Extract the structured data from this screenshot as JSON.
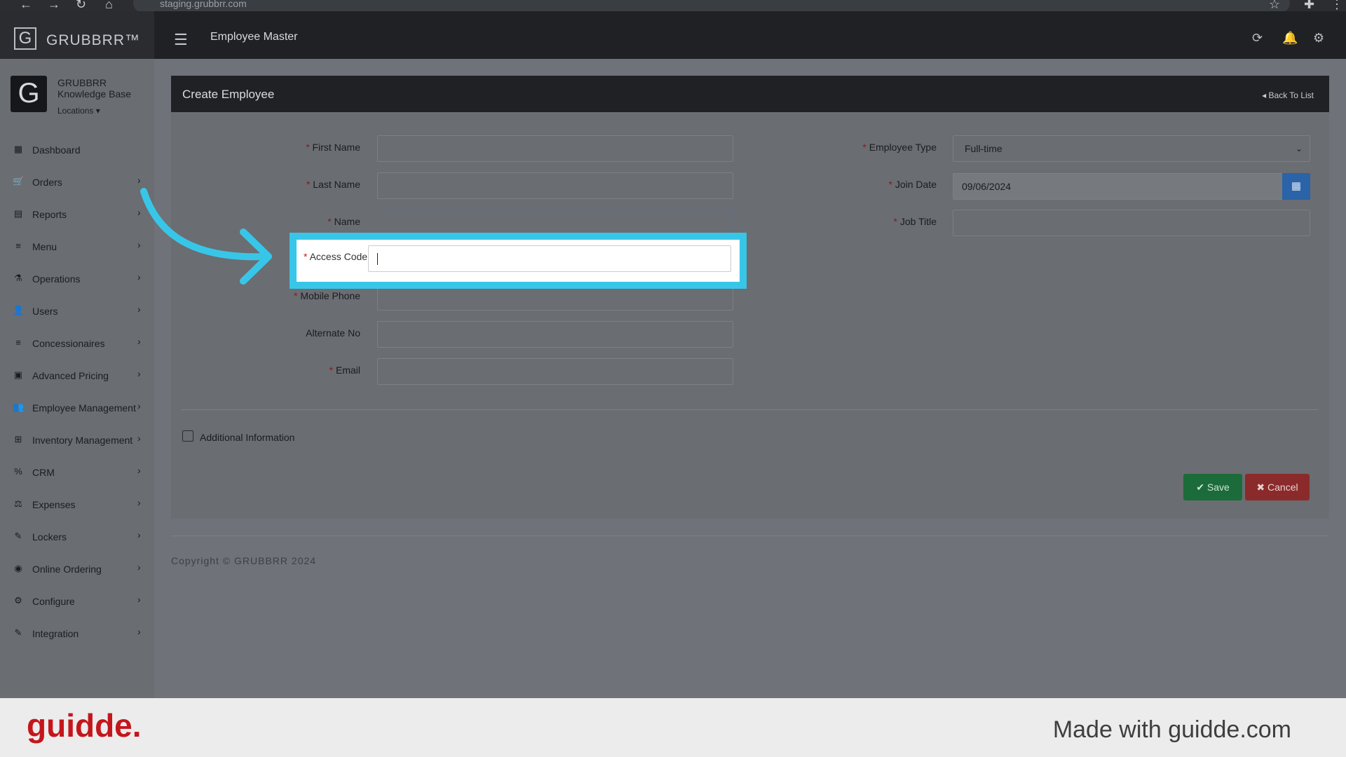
{
  "browser": {
    "url": "staging.grubbrr.com",
    "icons": [
      "back-icon",
      "forward-icon",
      "reload-icon",
      "home-icon",
      "star-icon",
      "extensions-icon",
      "more-icon"
    ]
  },
  "header": {
    "logo_letter": "G",
    "logo_text": "GRUBBRR™",
    "title": "Employee Master",
    "icons": [
      "refresh-icon",
      "bell-icon",
      "gear-icon"
    ]
  },
  "sidebar": {
    "brand_letter": "G",
    "brand_name": "GRUBBRR Knowledge Base",
    "locations_label": "Locations ▾",
    "items": [
      {
        "label": "Dashboard",
        "icon": "▦",
        "chevron": ""
      },
      {
        "label": "Orders",
        "icon": "🛒",
        "chevron": "›"
      },
      {
        "label": "Reports",
        "icon": "▤",
        "chevron": "›"
      },
      {
        "label": "Menu",
        "icon": "≡",
        "chevron": "›"
      },
      {
        "label": "Operations",
        "icon": "⚗",
        "chevron": "›"
      },
      {
        "label": "Users",
        "icon": "👤",
        "chevron": "›"
      },
      {
        "label": "Concessionaires",
        "icon": "≡",
        "chevron": "›"
      },
      {
        "label": "Advanced Pricing",
        "icon": "▣",
        "chevron": "›"
      },
      {
        "label": "Employee Management",
        "icon": "👥",
        "chevron": "›"
      },
      {
        "label": "Inventory Management",
        "icon": "⊞",
        "chevron": "›"
      },
      {
        "label": "CRM",
        "icon": "%",
        "chevron": "›"
      },
      {
        "label": "Expenses",
        "icon": "⚖",
        "chevron": "›"
      },
      {
        "label": "Lockers",
        "icon": "✎",
        "chevron": "›"
      },
      {
        "label": "Online Ordering",
        "icon": "◉",
        "chevron": "›"
      },
      {
        "label": "Configure",
        "icon": "⚙",
        "chevron": "›"
      },
      {
        "label": "Integration",
        "icon": "✎",
        "chevron": "›"
      }
    ]
  },
  "panel": {
    "title": "Create Employee",
    "back_link": "◂ Back To List"
  },
  "form": {
    "required_mark": "*",
    "first_name": {
      "label": "First Name",
      "value": ""
    },
    "last_name": {
      "label": "Last Name",
      "value": ""
    },
    "name": {
      "label": "Name",
      "value": ""
    },
    "access_code": {
      "label": "Access Code",
      "value": ""
    },
    "mobile_phone": {
      "label": "Mobile Phone",
      "value": ""
    },
    "alternate_no": {
      "label": "Alternate No",
      "value": ""
    },
    "email": {
      "label": "Email",
      "value": ""
    },
    "employee_type": {
      "label": "Employee Type",
      "value": "Full-time"
    },
    "join_date": {
      "label": "Join Date",
      "value": "09/06/2024"
    },
    "job_title": {
      "label": "Job Title",
      "value": ""
    },
    "additional_info_label": "Additional Information",
    "additional_info_checked": false
  },
  "actions": {
    "save_label": "✔ Save",
    "cancel_label": "✖ Cancel"
  },
  "footer": {
    "copyright": "Copyright © GRUBBRR 2024"
  },
  "guidde": {
    "logo": "guidde.",
    "made_with": "Made with guidde.com"
  },
  "colors": {
    "highlight": "#38c6e8",
    "save": "#1c6b3a",
    "cancel": "#8b2a2a",
    "guidde_brand": "#c4161c"
  }
}
